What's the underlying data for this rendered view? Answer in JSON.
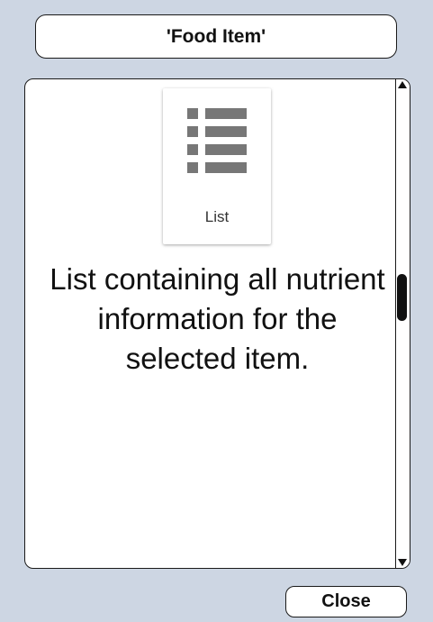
{
  "dialog": {
    "title": "'Food Item'"
  },
  "tile": {
    "icon": "list-icon",
    "label": "List"
  },
  "description": "List containing all nutrient information for the selected item.",
  "scroll": {
    "position": 0.44
  },
  "footer": {
    "close_label": "Close"
  },
  "colors": {
    "background": "#cdd6e3",
    "panel": "#ffffff",
    "icon": "#777777",
    "text": "#111111"
  }
}
